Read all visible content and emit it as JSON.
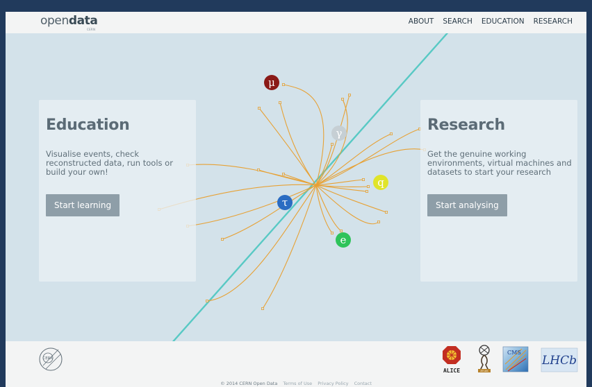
{
  "brand": {
    "logo_light": "open",
    "logo_bold": "data",
    "logo_sub": "CERN"
  },
  "nav": {
    "items": [
      "ABOUT",
      "SEARCH",
      "EDUCATION",
      "RESEARCH"
    ]
  },
  "education": {
    "title": "Education",
    "description": "Visualise events, check reconstructed data, run tools or build your own!",
    "button": "Start learning"
  },
  "research": {
    "title": "Research",
    "description": "Get the genuine working environments, virtual machines and datasets to start your research",
    "button": "Start analysing"
  },
  "particles": [
    {
      "symbol": "μ",
      "color": "#8a1a17"
    },
    {
      "symbol": "γ",
      "color": "#c6cfd4"
    },
    {
      "symbol": "q",
      "color": "#e0e42a"
    },
    {
      "symbol": "τ",
      "color": "#2a6cc2"
    },
    {
      "symbol": "e",
      "color": "#2ec35a"
    }
  ],
  "colors": {
    "track": "#e7a134",
    "beam": "#58c9c4",
    "background": "#d3e2ea",
    "frame": "#213a5c"
  },
  "footer": {
    "cern_logo": "CERN",
    "copyright": "© 2014 CERN Open Data",
    "links": [
      "Terms of Use",
      "Privacy Policy",
      "Contact"
    ],
    "experiments": [
      {
        "name": "ALICE",
        "label": "ALICE"
      },
      {
        "name": "ATLAS",
        "label": "ATLAS"
      },
      {
        "name": "CMS",
        "label": "CMS"
      },
      {
        "name": "LHCb",
        "label": "LHCb"
      }
    ]
  }
}
